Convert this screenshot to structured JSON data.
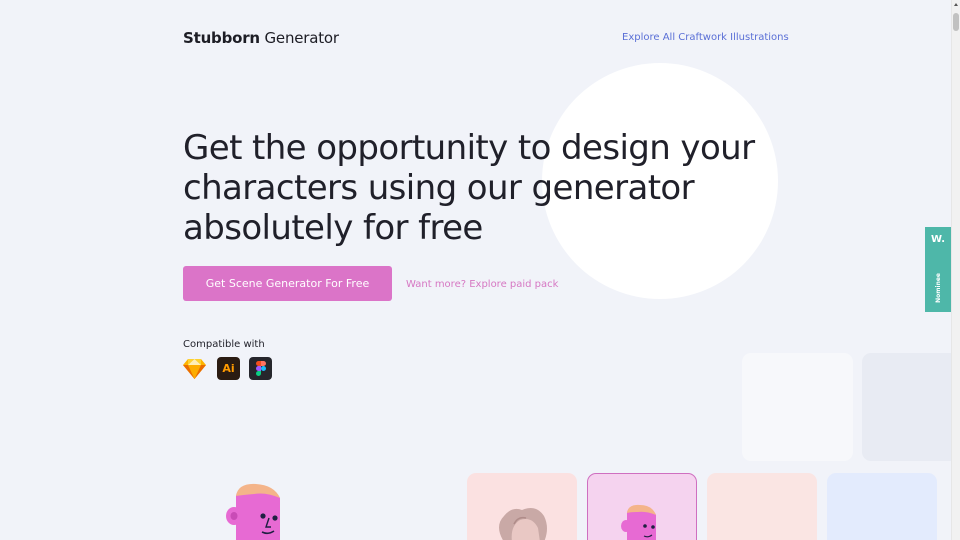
{
  "header": {
    "brand_bold": "Stubborn",
    "brand_light": "Generator",
    "explore_link": "Explore All Craftwork Illustrations"
  },
  "hero": {
    "headline_lines": [
      "Get the opportunity to design your",
      "characters using our generator",
      "absolutely for free"
    ],
    "cta_label": "Get Scene Generator For Free",
    "secondary_link": "Want more? Explore paid pack"
  },
  "compatible": {
    "label": "Compatible with",
    "apps": [
      {
        "icon": "sketch-icon"
      },
      {
        "icon": "illustrator-icon",
        "text": "Ai"
      },
      {
        "icon": "figma-icon"
      }
    ]
  },
  "badge": {
    "letter": "W.",
    "label": "Nominee"
  },
  "colors": {
    "background": "#f1f3f9",
    "cta": "#db74c8",
    "link_blue": "#5a6fd6",
    "link_pink": "#d678c3",
    "badge": "#4eb7a9"
  }
}
